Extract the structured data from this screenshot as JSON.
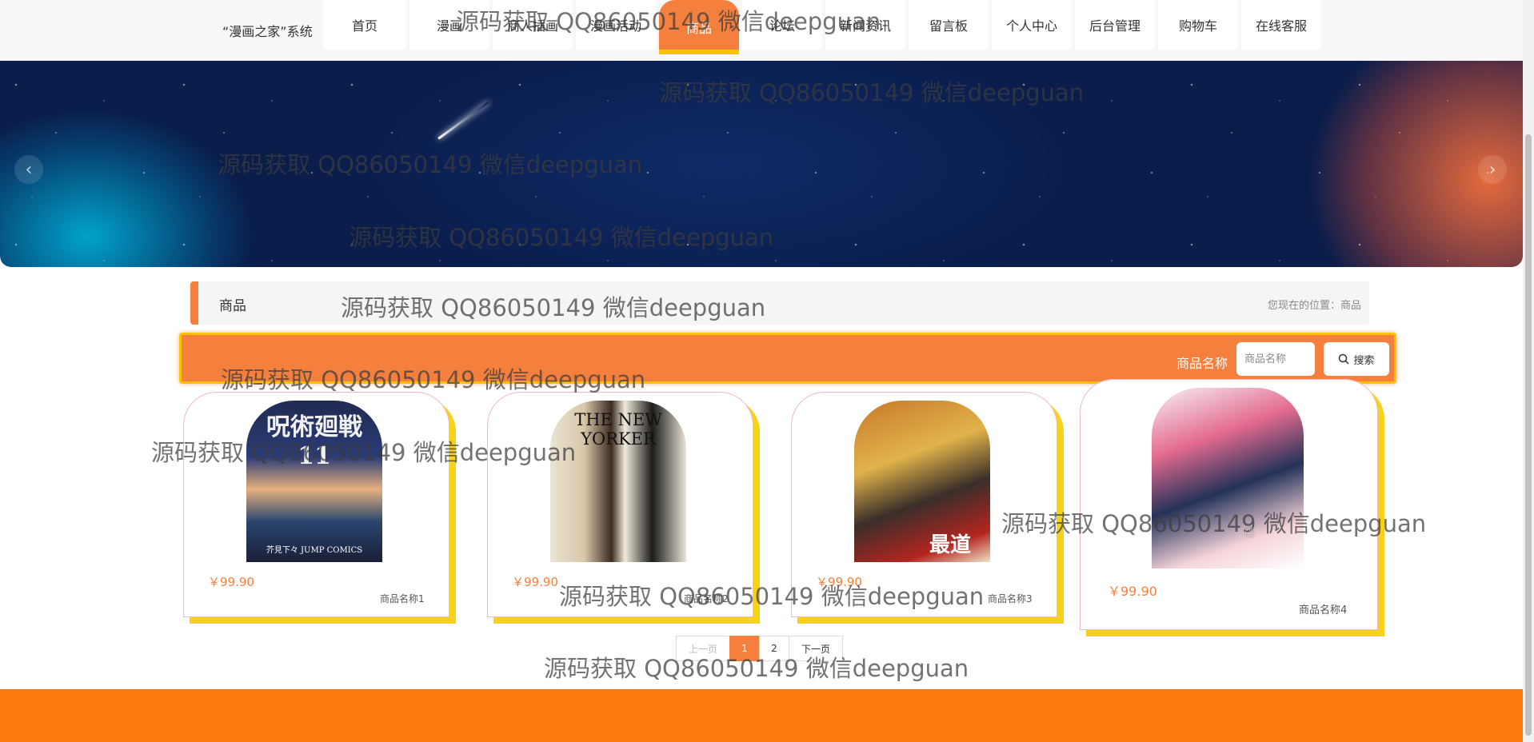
{
  "header": {
    "logo": "“漫画之家”系统",
    "nav": [
      {
        "label": "首页"
      },
      {
        "label": "漫画"
      },
      {
        "label": "商人插画"
      },
      {
        "label": "漫画活动"
      },
      {
        "label": "商品",
        "active": true
      },
      {
        "label": "论坛"
      },
      {
        "label": "新闻资讯"
      },
      {
        "label": "留言板"
      },
      {
        "label": "个人中心"
      },
      {
        "label": "后台管理"
      },
      {
        "label": "购物车"
      },
      {
        "label": "在线客服"
      }
    ]
  },
  "banner": {
    "prev_icon": "chevron-left-icon",
    "next_icon": "chevron-right-icon",
    "prev_glyph": "‹",
    "next_glyph": "›",
    "slide_count": 3,
    "active_slide": 1
  },
  "breadcrumb": {
    "title": "商品",
    "location": "您现在的位置：商品"
  },
  "search": {
    "label": "商品名称",
    "placeholder": "商品名称",
    "button_label": "搜索",
    "button_icon": "search-icon"
  },
  "products": [
    {
      "name": "商品名称1",
      "price": "￥99.90",
      "cover_text": "呪術廻戦 11",
      "cover_sub": "芥見下々 JUMP COMICS"
    },
    {
      "name": "商品名称2",
      "price": "￥99.90",
      "cover_text": "THE NEW YORKER",
      "cover_sub": ""
    },
    {
      "name": "商品名称3",
      "price": "￥99.90",
      "cover_text": "最道",
      "cover_sub": ""
    },
    {
      "name": "商品名称4",
      "price": "￥99.90",
      "cover_text": "",
      "cover_sub": ""
    }
  ],
  "pagination": {
    "prev": "上一页",
    "pages": [
      "1",
      "2"
    ],
    "current": "1",
    "next": "下一页"
  },
  "watermark": "源码获取 QQ86050149 微信deepguan",
  "colors": {
    "accent": "#f5803e",
    "highlight": "#f7d21a",
    "footer": "#ff7a0f"
  }
}
